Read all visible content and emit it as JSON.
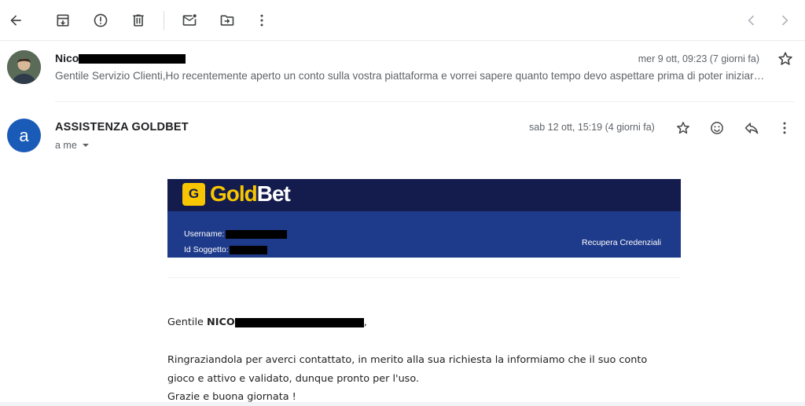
{
  "toolbar": {
    "icons": [
      "back-arrow-icon",
      "archive-icon",
      "report-spam-icon",
      "delete-icon",
      "mark-unread-icon",
      "move-to-icon",
      "more-vert-icon",
      "chevron-left-icon",
      "chevron-right-icon"
    ]
  },
  "message1": {
    "sender": "Nico",
    "date": "mer 9 ott, 09:23 (7 giorni fa)",
    "snippet": "Gentile Servizio Clienti,Ho recentemente aperto un conto sulla vostra piattaforma e vorrei sapere quanto tempo devo aspettare prima di poter iniziar…"
  },
  "message2": {
    "avatar_letter": "a",
    "sender": "ASSISTENZA GOLDBET",
    "recipient": "a me",
    "date": "sab 12 ott, 15:19 (4 giorni fa)",
    "banner": {
      "logo_gold": "Gold",
      "logo_bet": "Bet",
      "logo_mark": "G",
      "username_label": "Username:",
      "id_label": "Id Soggetto:",
      "recover_link": "Recupera Credenziali"
    },
    "greeting_prefix": "Gentile",
    "greeting_name": "NICO",
    "greeting_suffix": ",",
    "lines": [
      "Ringraziandola per averci contattato, in merito alla sua richiesta la informiamo che il suo conto",
      "gioco e attivo e validato, dunque pronto per l'uso.",
      "Grazie e buona giornata !"
    ]
  },
  "colors": {
    "avatar_blue": "#1a5bb8",
    "goldbet_navy": "#141b4d",
    "goldbet_blue": "#1e3a8a",
    "goldbet_yellow": "#f7c600"
  }
}
